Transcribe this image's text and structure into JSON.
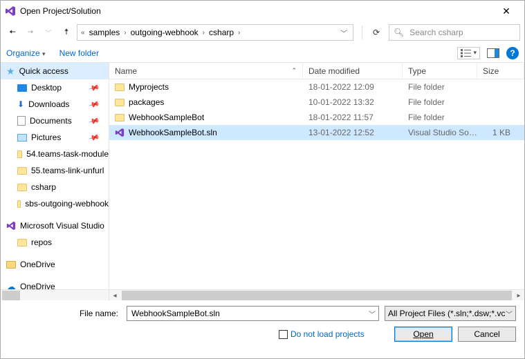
{
  "title": "Open Project/Solution",
  "breadcrumb": {
    "p0": "samples",
    "p1": "outgoing-webhook",
    "p2": "csharp"
  },
  "search": {
    "placeholder": "Search csharp"
  },
  "toolbar": {
    "organize": "Organize",
    "newfolder": "New folder"
  },
  "columns": {
    "name": "Name",
    "date": "Date modified",
    "type": "Type",
    "size": "Size"
  },
  "sidebar": {
    "quick": "Quick access",
    "desktop": "Desktop",
    "downloads": "Downloads",
    "documents": "Documents",
    "pictures": "Pictures",
    "t1": "54.teams-task-module",
    "t2": "55.teams-link-unfurl",
    "t3": "csharp",
    "t4": "sbs-outgoing-webhook",
    "mvs": "Microsoft Visual Studio",
    "repos": "repos",
    "od1": "OneDrive",
    "od2": "OneDrive"
  },
  "files": [
    {
      "name": "Myprojects",
      "date": "18-01-2022 12:09",
      "type": "File folder",
      "size": "",
      "kind": "folder"
    },
    {
      "name": "packages",
      "date": "10-01-2022 13:32",
      "type": "File folder",
      "size": "",
      "kind": "folder"
    },
    {
      "name": "WebhookSampleBot",
      "date": "18-01-2022 11:57",
      "type": "File folder",
      "size": "",
      "kind": "folder"
    },
    {
      "name": "WebhookSampleBot.sln",
      "date": "13-01-2022 12:52",
      "type": "Visual Studio Solu...",
      "size": "1 KB",
      "kind": "sln",
      "selected": true
    }
  ],
  "filename": {
    "label": "File name:",
    "value": "WebhookSampleBot.sln"
  },
  "filetype": "All Project Files (*.sln;*.dsw;*.vc",
  "checkbox": "Do not load projects",
  "buttons": {
    "open": "Open",
    "cancel": "Cancel"
  }
}
